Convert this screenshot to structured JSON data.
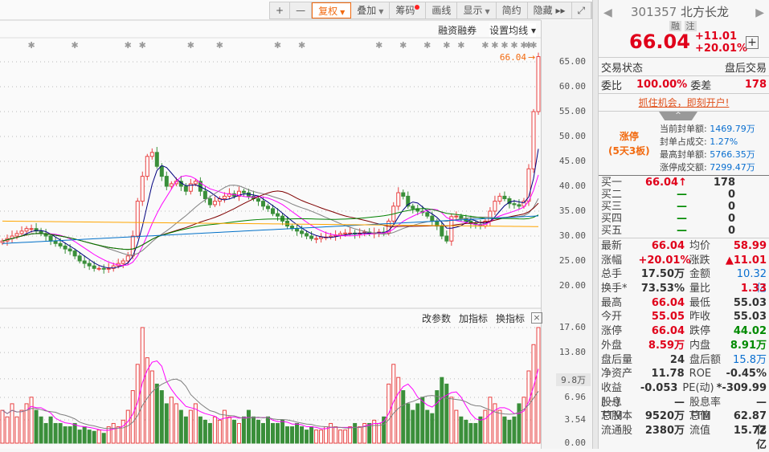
{
  "toolbar": {
    "items": [
      {
        "label": "+"
      },
      {
        "label": "—"
      },
      {
        "label": "复权",
        "dropdown": true,
        "active": true
      },
      {
        "label": "叠加",
        "dropdown": true
      },
      {
        "label": "筹码",
        "badge": true
      },
      {
        "label": "画线"
      },
      {
        "label": "显示",
        "dropdown": true
      },
      {
        "label": "简约"
      },
      {
        "label": "隐藏 ▸▸"
      },
      {
        "label": "⤢"
      }
    ]
  },
  "kline_header": {
    "margin": "融资融券",
    "ma_setting": "设置均线 ▾"
  },
  "price_axis": [
    "65.00",
    "60.00",
    "55.00",
    "50.00",
    "45.00",
    "40.00",
    "35.00",
    "30.00",
    "25.00",
    "20.00"
  ],
  "last_price_label": "66.04",
  "volume_header": {
    "edit_params": "改参数",
    "add_indicator": "加指标",
    "switch_indicator": "换指标",
    "close": "×"
  },
  "volume_axis": [
    "17.60",
    "13.80",
    "9.8万",
    "6.96",
    "3.54",
    "0.00"
  ],
  "chart_data": {
    "type": "candlestick",
    "price_range": [
      18,
      67
    ],
    "closes": [
      29,
      29.5,
      30,
      30.5,
      31,
      31.5,
      31.5,
      31,
      30.5,
      30,
      29,
      28.5,
      28,
      27.4,
      27,
      26,
      25,
      24.5,
      24,
      23.5,
      23.5,
      23.4,
      23.5,
      24,
      24.5,
      25,
      26,
      30,
      37,
      42,
      46,
      46.8,
      44,
      42,
      40,
      40.5,
      41,
      40,
      39,
      40.5,
      41,
      39,
      37.5,
      36.3,
      37,
      37.5,
      38,
      38.5,
      38,
      39,
      38.7,
      38,
      37.5,
      37,
      36,
      35.5,
      34.5,
      34,
      33,
      32,
      31.5,
      31,
      30.5,
      30,
      29.5,
      29.5,
      29.8,
      29.8,
      30,
      30.2,
      30.5,
      30.6,
      30.6,
      30.4,
      30.6,
      30.8,
      30.5,
      30.6,
      30.8,
      30.6,
      33,
      36,
      38.7,
      38,
      36,
      35.5,
      35,
      34.7,
      34,
      33,
      32,
      30,
      29,
      33.9,
      34,
      33.5,
      33,
      32.5,
      32.3,
      32,
      33,
      35,
      37,
      38,
      37.5,
      36.5,
      36.3,
      36,
      37,
      43.5,
      55,
      66.04
    ],
    "volumes": [
      5,
      4,
      6,
      4,
      5,
      6,
      7,
      5,
      4,
      3,
      4,
      3,
      3,
      2.5,
      2.5,
      3,
      2,
      2.5,
      2,
      1.8,
      2,
      1.5,
      2.5,
      3,
      2.5,
      3.5,
      5,
      8,
      12,
      17.6,
      13,
      11,
      9,
      8,
      6,
      7,
      6,
      5,
      4,
      5,
      6,
      4,
      3.5,
      3,
      4,
      3.5,
      5,
      4,
      3.5,
      3,
      4,
      5,
      4,
      3.5,
      3,
      4,
      3,
      3,
      3.5,
      2.5,
      2.5,
      3,
      2.5,
      2,
      2.5,
      2,
      2,
      2.5,
      3,
      2.5,
      2,
      2,
      2.5,
      3,
      2.5,
      3,
      3,
      3.5,
      3,
      4,
      9,
      12,
      10,
      8,
      6,
      5,
      6,
      7,
      5,
      4.5,
      8,
      10,
      9,
      7,
      5,
      4,
      3.5,
      3,
      3,
      4,
      5,
      7,
      6,
      5,
      4,
      3.5,
      4,
      6,
      7,
      11,
      15,
      17.6
    ],
    "volume_range": [
      0,
      17.6
    ],
    "ma_colors": [
      "#00007f",
      "#ff00ff",
      "#808080",
      "#7f0000",
      "#008000",
      "#0070c8",
      "#ffa500"
    ],
    "volume_ma_colors": [
      "#ff00ff",
      "#808080"
    ],
    "up_color": "#e84040",
    "down_color": "#3a8f3a",
    "markers": [
      6,
      15,
      26,
      29,
      39,
      45,
      57,
      62,
      78,
      83,
      88,
      92,
      95,
      100,
      102,
      104,
      106,
      108,
      109,
      110
    ]
  },
  "quote": {
    "code": "301357",
    "name": "北方长龙",
    "tags": [
      "融",
      "注"
    ],
    "price": "66.04",
    "change": "+11.01",
    "change_pct": "+20.01%",
    "status_label": "交易状态",
    "status_value": "盘后交易",
    "weibi_label": "委比",
    "weibi": "100.00%",
    "weicha_label": "委差",
    "weicha": "178",
    "promo": "抓住机会，即刻开户!",
    "limit_up": {
      "title": "涨停",
      "sub": "(5天3板)",
      "items": [
        {
          "label": "当前封单额:",
          "value": "1469.79万"
        },
        {
          "label": "封单占成交:",
          "value": "1.27%"
        },
        {
          "label": "最高封单额:",
          "value": "5766.35万"
        },
        {
          "label": "涨停成交额:",
          "value": "7299.47万"
        }
      ]
    },
    "bids": [
      {
        "label": "买一",
        "price": "66.04↑",
        "vol": "178"
      },
      {
        "label": "买二",
        "price": "—",
        "vol": "0"
      },
      {
        "label": "买三",
        "price": "—",
        "vol": "0"
      },
      {
        "label": "买四",
        "price": "—",
        "vol": "0"
      },
      {
        "label": "买五",
        "price": "—",
        "vol": "0"
      }
    ],
    "stats": [
      [
        "最新",
        "66.04",
        "red",
        "均价",
        "58.99",
        "red"
      ],
      [
        "涨幅",
        "+20.01%",
        "red",
        "涨跌",
        "▲11.01",
        "red"
      ],
      [
        "总手",
        "17.50万",
        "dk",
        "金额",
        "10.32亿",
        "blue"
      ],
      [
        "换手*",
        "73.53%",
        "dk",
        "量比",
        "1.33",
        "red"
      ],
      [
        "最高",
        "66.04",
        "red",
        "最低",
        "55.03",
        "dk"
      ],
      [
        "今开",
        "55.05",
        "red",
        "昨收",
        "55.03",
        "dk"
      ],
      [
        "涨停",
        "66.04",
        "red",
        "跌停",
        "44.02",
        "green"
      ],
      [
        "外盘",
        "8.59万",
        "red",
        "内盘",
        "8.91万",
        "green"
      ],
      [
        "盘后量",
        "24",
        "dk",
        "盘后额",
        "15.8万",
        "blue"
      ],
      [
        "净资产",
        "11.78",
        "dk",
        "ROE",
        "-0.45%",
        "dk"
      ],
      [
        "收益(一)",
        "-0.053",
        "dk",
        "PE(动)",
        "*-309.99",
        "dk"
      ],
      [
        "股息TTM",
        "—",
        "dk",
        "股息率TTM",
        "—",
        "dk"
      ],
      [
        "总股本",
        "9520万",
        "dk",
        "总值",
        "62.87亿",
        "dk"
      ],
      [
        "流通股",
        "2380万",
        "dk",
        "流值",
        "15.72亿",
        "dk"
      ]
    ]
  }
}
